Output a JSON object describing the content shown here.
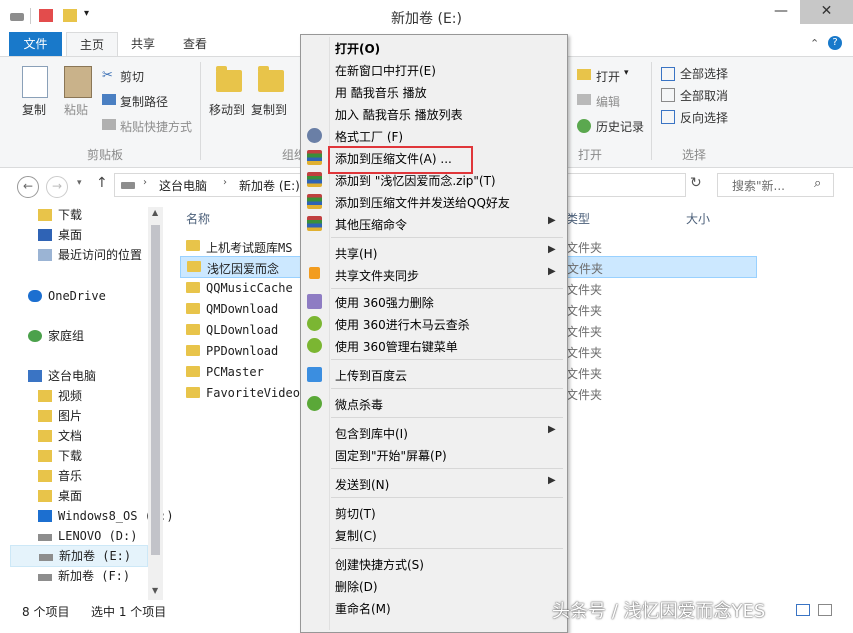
{
  "window": {
    "title": "新加卷 (E:)",
    "minimize_glyph": "—",
    "maximize_glyph": "☐",
    "close_glyph": "✕"
  },
  "ribbon_tabs": [
    "文件",
    "主页",
    "共享",
    "查看"
  ],
  "ribbon": {
    "copy": "复制",
    "paste": "粘贴",
    "cut": "剪切",
    "copy_path": "复制路径",
    "paste_shortcut": "粘贴快捷方式",
    "clipboard_group": "剪贴板",
    "move_to": "移动到",
    "copy_to": "复制到",
    "organize_group": "组织",
    "open": "打开",
    "edit": "编辑",
    "history": "历史记录",
    "open_group": "打开",
    "select_all": "全部选择",
    "select_none": "全部取消",
    "invert_selection": "反向选择",
    "select_group": "选择"
  },
  "address": {
    "crumbs": [
      "这台电脑",
      "新加卷 (E:)"
    ],
    "search_placeholder": "搜索\"新..."
  },
  "nav_pane": [
    {
      "label": "下载",
      "icon": "download-folder-icon"
    },
    {
      "label": "桌面",
      "icon": "desktop-icon"
    },
    {
      "label": "最近访问的位置",
      "icon": "recent-places-icon"
    },
    {
      "label": "OneDrive",
      "icon": "onedrive-icon"
    },
    {
      "label": "家庭组",
      "icon": "homegroup-icon"
    },
    {
      "label": "这台电脑",
      "icon": "computer-icon"
    },
    {
      "label": "视频",
      "icon": "videos-folder-icon"
    },
    {
      "label": "图片",
      "icon": "pictures-folder-icon"
    },
    {
      "label": "文档",
      "icon": "documents-folder-icon"
    },
    {
      "label": "下载",
      "icon": "download-folder-icon"
    },
    {
      "label": "音乐",
      "icon": "music-folder-icon"
    },
    {
      "label": "桌面",
      "icon": "desktop-folder-icon"
    },
    {
      "label": "Windows8_OS (C:)",
      "icon": "system-drive-icon"
    },
    {
      "label": "LENOVO (D:)",
      "icon": "drive-icon"
    },
    {
      "label": "新加卷 (E:)",
      "icon": "drive-icon"
    },
    {
      "label": "新加卷 (F:)",
      "icon": "drive-icon"
    }
  ],
  "file_list": {
    "headers": {
      "name": "名称",
      "type": "类型",
      "size": "大小"
    },
    "rows": [
      {
        "name": "上机考试题库MS",
        "type": "文件夹"
      },
      {
        "name": "浅忆因爱而念",
        "type": "文件夹"
      },
      {
        "name": "QQMusicCache",
        "type": "文件夹"
      },
      {
        "name": "QMDownload",
        "type": "文件夹"
      },
      {
        "name": "QLDownload",
        "type": "文件夹"
      },
      {
        "name": "PPDownload",
        "type": "文件夹"
      },
      {
        "name": "PCMaster",
        "type": "文件夹"
      },
      {
        "name": "FavoriteVideo",
        "type": "文件夹"
      }
    ]
  },
  "status": {
    "count": "8 个项目",
    "selected": "选中 1 个项目"
  },
  "context_menu": [
    {
      "label": "打开(O)",
      "bold": true
    },
    {
      "label": "在新窗口中打开(E)"
    },
    {
      "label": "用 酷我音乐 播放"
    },
    {
      "label": "加入 酷我音乐 播放列表"
    },
    {
      "label": "格式工厂 (F)",
      "icon": "format-factory-icon"
    },
    {
      "label": "添加到压缩文件(A) ...",
      "icon": "winrar-icon",
      "highlight": true
    },
    {
      "label": "添加到 \"浅忆因爱而念.zip\"(T)",
      "icon": "winrar-icon"
    },
    {
      "label": "添加到压缩文件并发送给QQ好友",
      "icon": "winrar-icon"
    },
    {
      "label": "其他压缩命令",
      "icon": "winrar-icon",
      "submenu": true
    },
    {
      "label": "共享(H)",
      "submenu": true
    },
    {
      "label": "共享文件夹同步",
      "icon": "sync-icon",
      "submenu": true
    },
    {
      "label": "使用 360强力删除",
      "icon": "360-delete-icon"
    },
    {
      "label": "使用 360进行木马云查杀",
      "icon": "360-scan-icon"
    },
    {
      "label": "使用 360管理右键菜单",
      "icon": "360-menu-icon"
    },
    {
      "label": "上传到百度云",
      "icon": "baidu-cloud-icon"
    },
    {
      "label": "微点杀毒",
      "icon": "weidian-antivirus-icon"
    },
    {
      "label": "包含到库中(I)",
      "submenu": true
    },
    {
      "label": "固定到\"开始\"屏幕(P)"
    },
    {
      "label": "发送到(N)",
      "submenu": true
    },
    {
      "label": "剪切(T)"
    },
    {
      "label": "复制(C)"
    },
    {
      "label": "创建快捷方式(S)"
    },
    {
      "label": "删除(D)"
    },
    {
      "label": "重命名(M)"
    }
  ],
  "watermark": "头条号 / 浅忆因爱而念YES",
  "colors": {
    "accent": "#1979ca",
    "highlight_box": "#e0363a",
    "folder": "#e8c44a",
    "selection": "#cce8ff"
  }
}
